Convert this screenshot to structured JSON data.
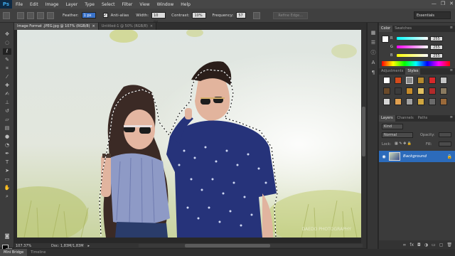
{
  "app": {
    "logo": "Ps"
  },
  "menu": [
    "File",
    "Edit",
    "Image",
    "Layer",
    "Type",
    "Select",
    "Filter",
    "View",
    "Window",
    "Help"
  ],
  "window_controls": [
    "—",
    "❐",
    "✕"
  ],
  "options": {
    "feather_label": "Feather:",
    "feather_value": "1 px",
    "anti_alias_label": "Anti-alias",
    "width_label": "Width:",
    "width_value": "10 px",
    "contrast_label": "Contrast:",
    "contrast_value": "10%",
    "frequency_label": "Frequency:",
    "frequency_value": "57",
    "refine_edge": "Refine Edge...",
    "workspace": "Essentials"
  },
  "tabs": [
    {
      "label": "Image Format .JPEG.jpg @ 107% (RGB/8)",
      "active": true
    },
    {
      "label": "Untitled-1 @ 50% (RGB/8)",
      "active": false
    }
  ],
  "tab_close_glyph": "×",
  "status": {
    "zoom": "107.37%",
    "doc": "Doc: 1,83M/1,83M"
  },
  "bottom_tabs": [
    "Mini Bridge",
    "Timeline"
  ],
  "canvas": {
    "watermark": "DAEDO PHOTOGRAPHY"
  },
  "color_panel": {
    "tabs": [
      "Color",
      "Swatches"
    ],
    "rows": [
      {
        "label": "R",
        "value": "255"
      },
      {
        "label": "G",
        "value": "255"
      },
      {
        "label": "B",
        "value": "255"
      }
    ]
  },
  "styles_panel": {
    "tabs": [
      "Adjustments",
      "Styles"
    ]
  },
  "layers_panel": {
    "tabs": [
      "Layers",
      "Channels",
      "Paths"
    ],
    "kind": "Kind",
    "blend_mode": "Normal",
    "opacity_label": "Opacity:",
    "lock_label": "Lock:",
    "fill_label": "Fill:",
    "layer_name": "Background"
  },
  "colors": {
    "accent": "#2c6bbb",
    "ps_blue": "#3ea7e8"
  }
}
